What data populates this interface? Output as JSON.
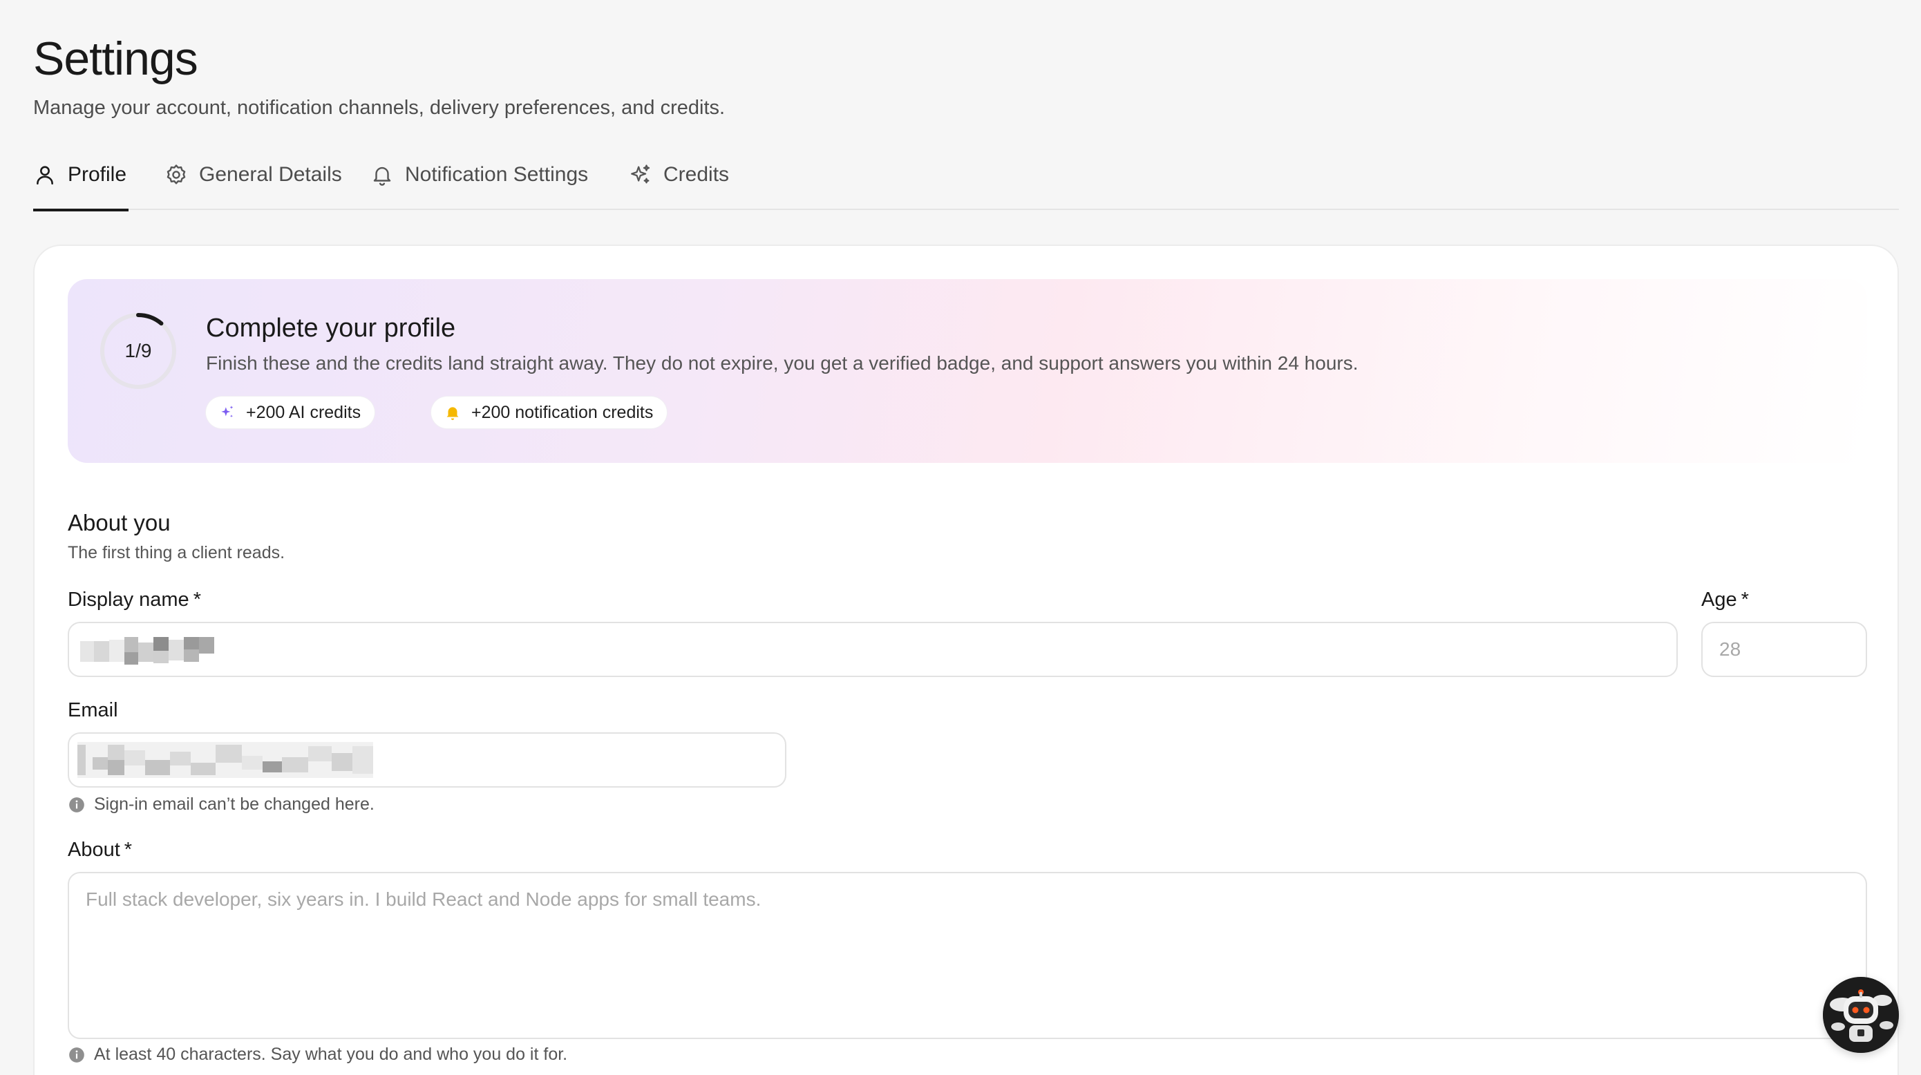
{
  "header": {
    "title": "Settings",
    "subtitle": "Manage your account, notification channels, delivery preferences, and credits."
  },
  "tabs": [
    {
      "label": "Profile",
      "icon": "user-icon",
      "active": true
    },
    {
      "label": "General Details",
      "icon": "gear-icon",
      "active": false
    },
    {
      "label": "Notification Settings",
      "icon": "bell-icon",
      "active": false
    },
    {
      "label": "Credits",
      "icon": "sparkles-icon",
      "active": false
    }
  ],
  "profile_banner": {
    "progress_text": "1/9",
    "progress_fraction": 0.111,
    "title": "Complete your profile",
    "description": "Finish these and the credits land straight away. They do not expire, you get a verified badge, and support answers you within 24 hours.",
    "chips": [
      {
        "label": "+200 AI credits",
        "icon": "sparkles-icon"
      },
      {
        "label": "+200 notification credits",
        "icon": "bell-icon"
      }
    ]
  },
  "about_section": {
    "title": "About you",
    "subtitle": "The first thing a client reads."
  },
  "form": {
    "display_name": {
      "label": "Display name",
      "required_mark": "*"
    },
    "age": {
      "label": "Age",
      "required_mark": "*",
      "placeholder": "28"
    },
    "email": {
      "label": "Email",
      "hint": "Sign-in email can’t be changed here."
    },
    "about": {
      "label": "About",
      "required_mark": "*",
      "placeholder": "Full stack developer, six years in. I build React and Node apps for small teams.",
      "hint": "At least 40 characters. Say what you do and who you do it for."
    }
  },
  "colors": {
    "accent_dark": "#1a1a1a",
    "ai_credit_purple": "#7b5cf0",
    "notification_yellow": "#f5b800",
    "bot_eyes": "#ff5a1f"
  }
}
